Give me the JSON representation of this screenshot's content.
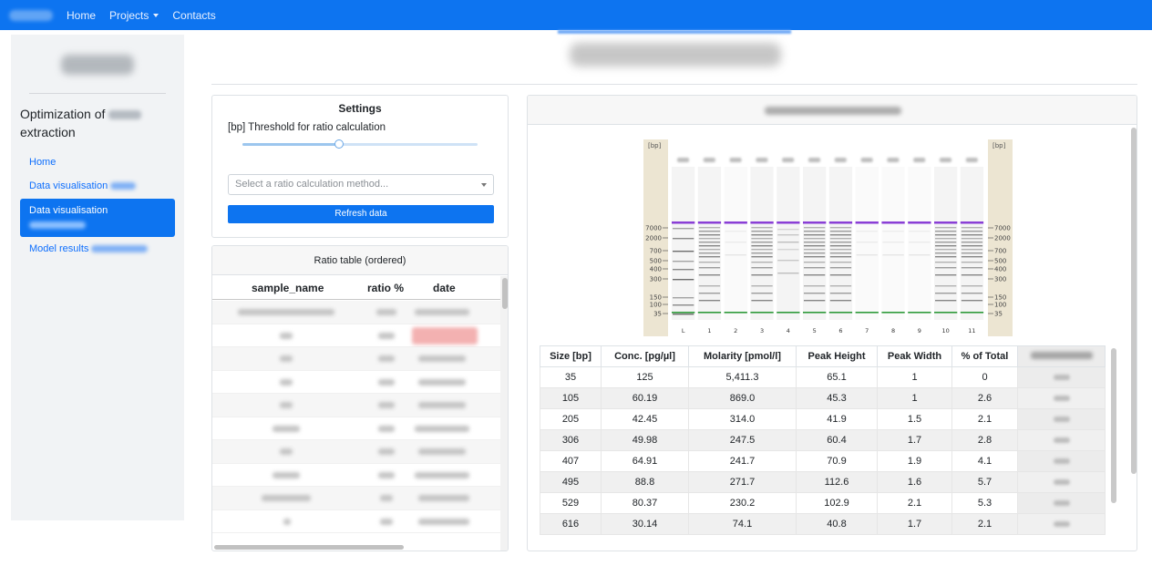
{
  "navbar": {
    "links": [
      {
        "label": "Home"
      },
      {
        "label": "Projects"
      },
      {
        "label": "Contacts"
      }
    ]
  },
  "sidebar": {
    "title_prefix": "Optimization of",
    "title_suffix": "extraction",
    "items": [
      {
        "label": "Home"
      },
      {
        "label": "Data visualisation"
      },
      {
        "label": "Data visualisation"
      },
      {
        "label": "Model results"
      }
    ]
  },
  "settings": {
    "title": "Settings",
    "threshold_label": "[bp] Threshold for ratio calculation",
    "slider_value": 0.41,
    "select_placeholder": "Select a ratio calculation method...",
    "refresh_label": "Refresh data"
  },
  "ratio_table": {
    "title": "Ratio table (ordered)",
    "columns": [
      "sample_name",
      "ratio %",
      "date"
    ]
  },
  "gel": {
    "bp_unit": "[bp]",
    "ladder_ticks": [
      "7000",
      "2000",
      "700",
      "500",
      "400",
      "300",
      "150",
      "100",
      "35"
    ],
    "lane_numbers": [
      "L",
      "1",
      "2",
      "3",
      "4",
      "5",
      "6",
      "7",
      "8",
      "9",
      "10",
      "11"
    ]
  },
  "peak_table": {
    "columns": [
      "Size [bp]",
      "Conc. [pg/µl]",
      "Molarity [pmol/l]",
      "Peak Height",
      "Peak Width",
      "% of Total"
    ],
    "rows": [
      [
        "35",
        "125",
        "5,411.3",
        "65.1",
        "1",
        "0"
      ],
      [
        "105",
        "60.19",
        "869.0",
        "45.3",
        "1",
        "2.6"
      ],
      [
        "205",
        "42.45",
        "314.0",
        "41.9",
        "1.5",
        "2.1"
      ],
      [
        "306",
        "49.98",
        "247.5",
        "60.4",
        "1.7",
        "2.8"
      ],
      [
        "407",
        "64.91",
        "241.7",
        "70.9",
        "1.9",
        "4.1"
      ],
      [
        "495",
        "88.8",
        "271.7",
        "112.6",
        "1.6",
        "5.7"
      ],
      [
        "529",
        "80.37",
        "230.2",
        "102.9",
        "2.1",
        "5.3"
      ],
      [
        "616",
        "30.14",
        "74.1",
        "40.8",
        "1.7",
        "2.1"
      ]
    ]
  },
  "colors": {
    "brand": "#0d74f0",
    "ladder_top_marker": "#8a3fd6",
    "ladder_bottom_marker": "#2e9a3a"
  }
}
